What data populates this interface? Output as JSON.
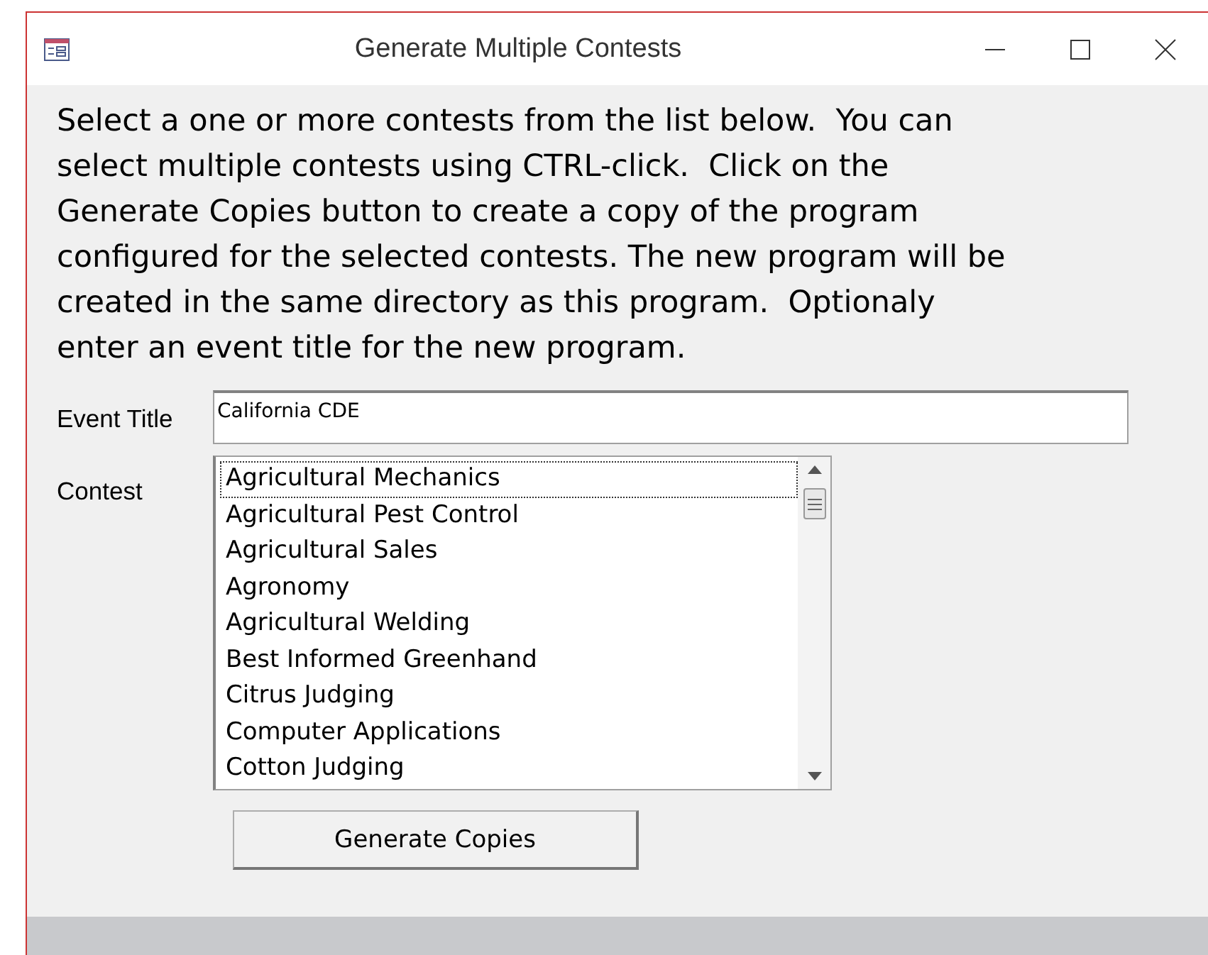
{
  "window": {
    "title": "Generate Multiple Contests"
  },
  "instructions": "Select a one or more contests from the list below.  You can select multiple contests using CTRL-click.  Click on the Generate Copies button to create a copy of the program configured for the selected contests. The new program will be created in the same directory as this program.  Optionaly enter an event title for the new program.",
  "event_title": {
    "label": "Event Title",
    "value": "California CDE"
  },
  "contest": {
    "label": "Contest",
    "items": [
      {
        "text": "Agricultural Mechanics",
        "focused": true
      },
      {
        "text": "Agricultural Pest Control",
        "focused": false
      },
      {
        "text": "Agricultural Sales",
        "focused": false
      },
      {
        "text": "Agronomy",
        "focused": false
      },
      {
        "text": "Agricultural Welding",
        "focused": false
      },
      {
        "text": "Best Informed Greenhand",
        "focused": false
      },
      {
        "text": "Citrus Judging",
        "focused": false
      },
      {
        "text": "Computer Applications",
        "focused": false
      },
      {
        "text": "Cotton Judging",
        "focused": false
      }
    ]
  },
  "button": "Generate Copies"
}
